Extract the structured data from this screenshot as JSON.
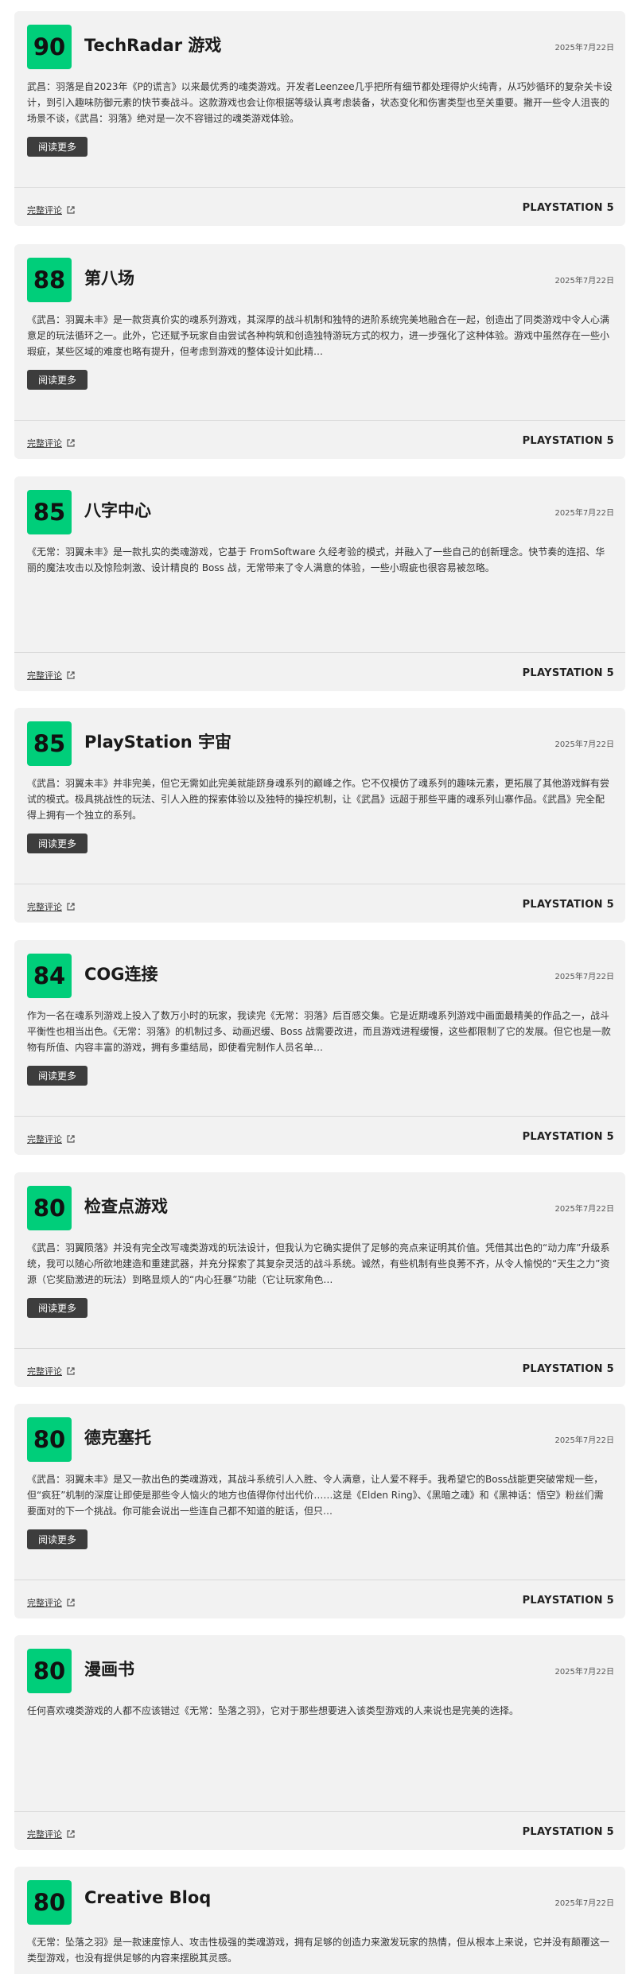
{
  "reviews": [
    {
      "score": "90",
      "outlet": "TechRadar 游戏",
      "date": "2025年7月22日",
      "text": "武昌：羽落是自2023年《P的谎言》以来最优秀的魂类游戏。开发者Leenzee几乎把所有细节都处理得炉火纯青，从巧妙循环的复杂关卡设计，到引入趣味防御元素的快节奏战斗。这款游戏也会让你根据等级认真考虑装备，状态变化和伤害类型也至关重要。撇开一些令人沮丧的场景不谈，《武昌：羽落》绝对是一次不容错过的魂类游戏体验。",
      "read_more": "阅读更多",
      "full_review": "完整评论",
      "platform": "PLAYSTATION 5"
    },
    {
      "score": "88",
      "outlet": "第八场",
      "date": "2025年7月22日",
      "text": "《武昌：羽翼未丰》是一款货真价实的魂系列游戏，其深厚的战斗机制和独特的进阶系统完美地融合在一起，创造出了同类游戏中令人心满意足的玩法循环之一。此外，它还赋予玩家自由尝试各种构筑和创造独特游玩方式的权力，进一步强化了这种体验。游戏中虽然存在一些小瑕疵，某些区域的难度也略有提升，但考虑到游戏的整体设计如此精…",
      "read_more": "阅读更多",
      "full_review": "完整评论",
      "platform": "PLAYSTATION 5"
    },
    {
      "score": "85",
      "outlet": "八字中心",
      "date": "2025年7月22日",
      "text": "《无常：羽翼未丰》是一款扎实的类魂游戏，它基于 FromSoftware 久经考验的模式，并融入了一些自己的创新理念。快节奏的连招、华丽的魔法攻击以及惊险刺激、设计精良的 Boss 战，无常带来了令人满意的体验，一些小瑕疵也很容易被忽略。",
      "read_more": "",
      "full_review": "完整评论",
      "platform": "PLAYSTATION 5"
    },
    {
      "score": "85",
      "outlet": "PlayStation 宇宙",
      "date": "2025年7月22日",
      "text": "《武昌：羽翼未丰》并非完美，但它无需如此完美就能跻身魂系列的巅峰之作。它不仅模仿了魂系列的趣味元素，更拓展了其他游戏鲜有尝试的模式。极具挑战性的玩法、引人入胜的探索体验以及独特的操控机制，让《武昌》远超于那些平庸的魂系列山寨作品。《武昌》完全配得上拥有一个独立的系列。",
      "read_more": "阅读更多",
      "full_review": "完整评论",
      "platform": "PLAYSTATION 5"
    },
    {
      "score": "84",
      "outlet": "COG连接",
      "date": "2025年7月22日",
      "text": "作为一名在魂系列游戏上投入了数万小时的玩家，我读完《无常：羽落》后百感交集。它是近期魂系列游戏中画面最精美的作品之一，战斗平衡性也相当出色。《无常：羽落》的机制过多、动画迟缓、Boss 战需要改进，而且游戏进程缓慢，这些都限制了它的发展。但它也是一款物有所值、内容丰富的游戏，拥有多重结局，即使看完制作人员名单…",
      "read_more": "阅读更多",
      "full_review": "完整评论",
      "platform": "PLAYSTATION 5"
    },
    {
      "score": "80",
      "outlet": "检查点游戏",
      "date": "2025年7月22日",
      "text": "《武昌：羽翼陨落》并没有完全改写魂类游戏的玩法设计，但我认为它确实提供了足够的亮点来证明其价值。凭借其出色的“动力库”升级系统，我可以随心所欲地建造和重建武器，并充分探索了其复杂灵活的战斗系统。诚然，有些机制有些良莠不齐，从令人愉悦的“天生之力”资源（它奖励激进的玩法）到略显烦人的“内心狂暴”功能（它让玩家角色…",
      "read_more": "阅读更多",
      "full_review": "完整评论",
      "platform": "PLAYSTATION 5"
    },
    {
      "score": "80",
      "outlet": "德克塞托",
      "date": "2025年7月22日",
      "text": "《武昌：羽翼未丰》是又一款出色的类魂游戏，其战斗系统引人入胜、令人满意，让人爱不释手。我希望它的Boss战能更突破常规一些，但“疯狂”机制的深度让即使是那些令人恼火的地方也值得你付出代价……这是《Elden Ring》、《黑暗之魂》和《黑神话：悟空》粉丝们需要面对的下一个挑战。你可能会说出一些连自己都不知道的脏话，但只…",
      "read_more": "阅读更多",
      "full_review": "完整评论",
      "platform": "PLAYSTATION 5"
    },
    {
      "score": "80",
      "outlet": "漫画书",
      "date": "2025年7月22日",
      "text": "任何喜欢魂类游戏的人都不应该错过《无常：坠落之羽》，它对于那些想要进入该类型游戏的人来说也是完美的选择。",
      "read_more": "",
      "full_review": "完整评论",
      "platform": "PLAYSTATION 5"
    },
    {
      "score": "80",
      "outlet": "Creative Bloq",
      "date": "2025年7月22日",
      "text": "《无常：坠落之羽》是一款速度惊人、攻击性极强的类魂游戏，拥有足够的创造力来激发玩家的热情，但从根本上来说，它并没有颠覆这一类型游戏，也没有提供足够的内容来摆脱其灵感。",
      "read_more": "",
      "full_review": "",
      "platform": ""
    }
  ]
}
